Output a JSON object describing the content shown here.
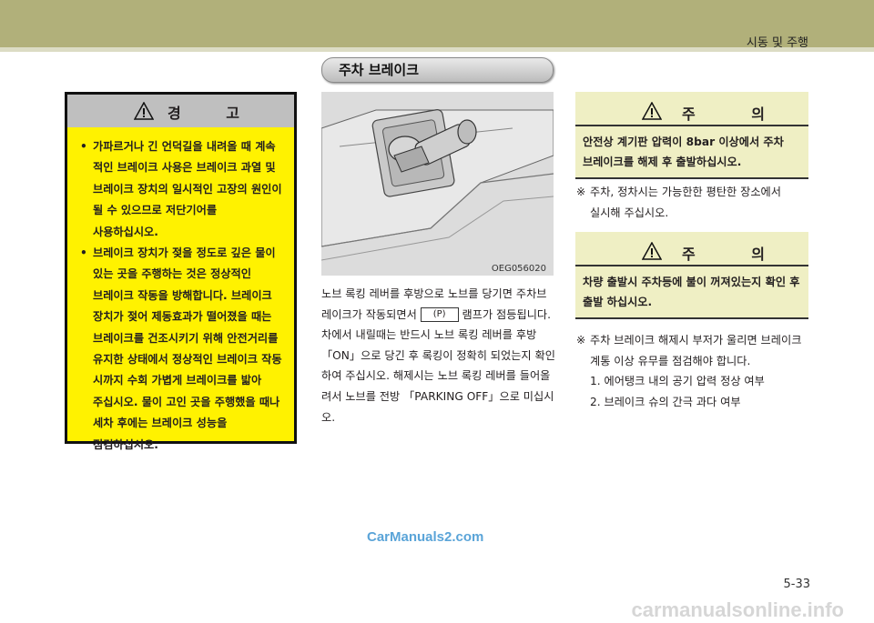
{
  "header": {
    "chapter": "시동 및 주행"
  },
  "section": {
    "title": "주차 브레이크"
  },
  "warning": {
    "title": "경 고",
    "items": [
      "가파르거나 긴 언덕길을 내려올 때 계속 적인 브레이크 사용은 브레이크 과열 및 브레이크 장치의 일시적인 고장의 원인이 될 수 있으므로 저단기어를 사용하십시오.",
      "브레이크 장치가 젖을 정도로 깊은 물이 있는 곳을 주행하는 것은 정상적인 브레이크 작동을 방해합니다. 브레이크 장치가 젖어 제동효과가 떨어졌을 때는 브레이크를 건조시키기 위해 안전거리를 유지한 상태에서 정상적인 브레이크 작동 시까지 수회 가볍게 브레이크를 밟아 주십시오. 물이 고인 곳을 주행했을 때나 세차 후에는 브레이크 성능을 점검하십시오."
    ]
  },
  "figure": {
    "code": "OEG056020",
    "knob_label": "PARKING OFF",
    "on_label": "ON"
  },
  "body": {
    "part1": "노브 록킹 레버를 후방으로 노브를 당기면 주차브레이크가 작동되면서",
    "lamp_symbol": "(P)",
    "part2": "램프가 점등됩니다. 차에서 내릴때는 반드시 노브 록킹 레버를 후방 「ON」으로 당긴 후 록킹이 정확히 되었는지 확인하여 주십시오. 해제시는 노브 록킹 레버를 들어올려서 노브를 전방 「PARKING OFF」으로 미십시오."
  },
  "caution1": {
    "title": "주 의",
    "text": "안전상 계기판 압력이 8bar 이상에서 주차 브레이크를 해제 후 출발하십시오."
  },
  "note1": {
    "mark": "※",
    "text": "주차, 정차시는 가능한한 평탄한 장소에서 실시해 주십시오."
  },
  "caution2": {
    "title": "주 의",
    "text": "차량 출발시 주차등에 불이 꺼져있는지 확인 후 출발 하십시오."
  },
  "note2": {
    "mark": "※",
    "text": "주차 브레이크 해제시 부저가 울리면 브레이크 계통 이상 유무를 점검해야 합니다.",
    "items": [
      "1. 에어탱크 내의 공기 압력 정상 여부",
      "2. 브레이크 슈의 간극 과다 여부"
    ]
  },
  "page_number": "5-33",
  "watermark": "CarManuals2.com",
  "footer": "carmanualsonline.info"
}
